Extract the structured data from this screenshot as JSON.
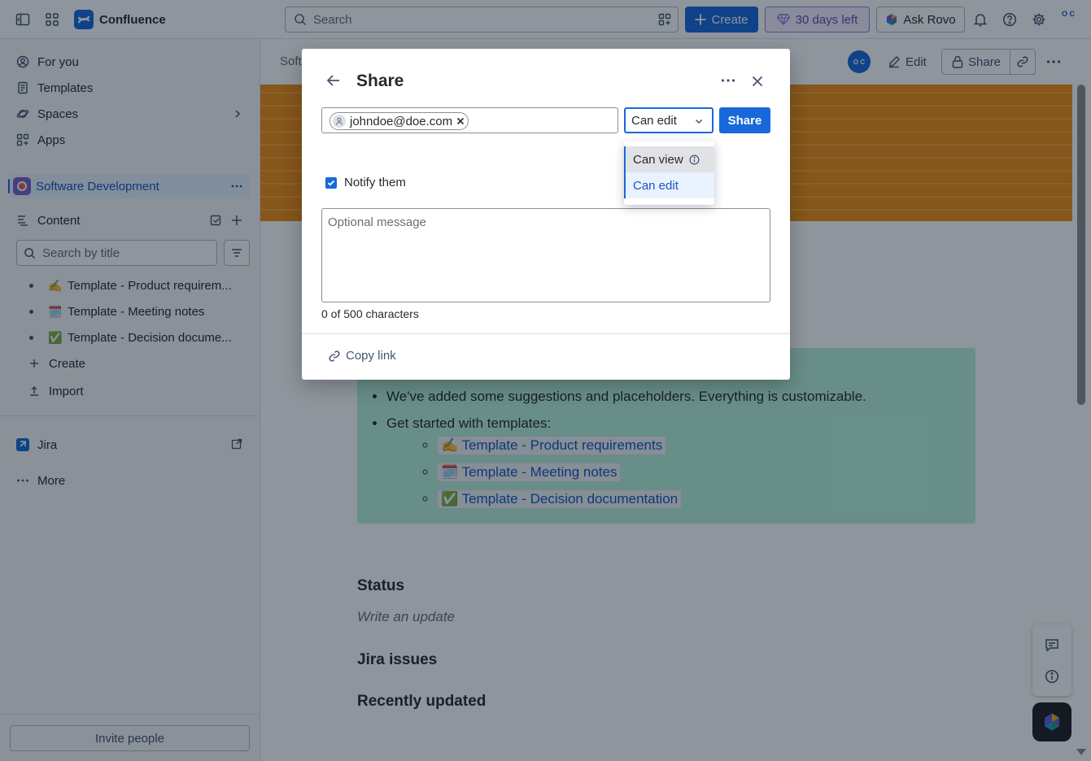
{
  "topbar": {
    "app_name": "Confluence",
    "search_placeholder": "Search",
    "create_label": "Create",
    "trial_label": "30 days left",
    "rovo_label": "Ask Rovo",
    "avatar_initials": "O C"
  },
  "sidebar": {
    "nav": [
      {
        "label": "For you",
        "icon": "person-circle-icon"
      },
      {
        "label": "Templates",
        "icon": "template-icon"
      },
      {
        "label": "Spaces",
        "icon": "planet-icon"
      },
      {
        "label": "Apps",
        "icon": "apps-icon"
      }
    ],
    "space_name": "Software Development",
    "content_label": "Content",
    "search_placeholder": "Search by title",
    "tree": [
      {
        "emoji": "✍️",
        "label": "Template - Product requirem..."
      },
      {
        "emoji": "🗓️",
        "label": "Template - Meeting notes"
      },
      {
        "emoji": "✅",
        "label": "Template - Decision docume..."
      }
    ],
    "create_label": "Create",
    "import_label": "Import",
    "jira_label": "Jira",
    "more_label": "More",
    "invite_label": "Invite people"
  },
  "page": {
    "breadcrumb_fragment": "Soft",
    "avatar_initials": "O C",
    "edit_label": "Edit",
    "share_label": "Share",
    "bullets": [
      "We've added some suggestions and placeholders. Everything is customizable.",
      "Get started with templates:"
    ],
    "template_links": [
      {
        "emoji": "✍️",
        "label": "Template - Product requirements"
      },
      {
        "emoji": "🗓️",
        "label": "Template - Meeting notes"
      },
      {
        "emoji": "✅",
        "label": "Template - Decision documentation"
      }
    ],
    "status_heading": "Status",
    "status_placeholder": "Write an update",
    "jira_heading": "Jira issues",
    "recent_heading": "Recently updated"
  },
  "share_dialog": {
    "title": "Share",
    "recipient_tag": "johndoe@doe.com",
    "permission_value": "Can edit",
    "permission_options": [
      {
        "label": "Can view",
        "state": "hover"
      },
      {
        "label": "Can edit",
        "state": "selected"
      }
    ],
    "share_button": "Share",
    "notify_label": "Notify them",
    "notify_checked": true,
    "message_placeholder": "Optional message",
    "char_counter": "0 of 500 characters",
    "copy_link_label": "Copy link"
  },
  "colors": {
    "brand_blue": "#1868db",
    "banner_orange": "#f18d13",
    "callout_green": "#baf3db"
  }
}
